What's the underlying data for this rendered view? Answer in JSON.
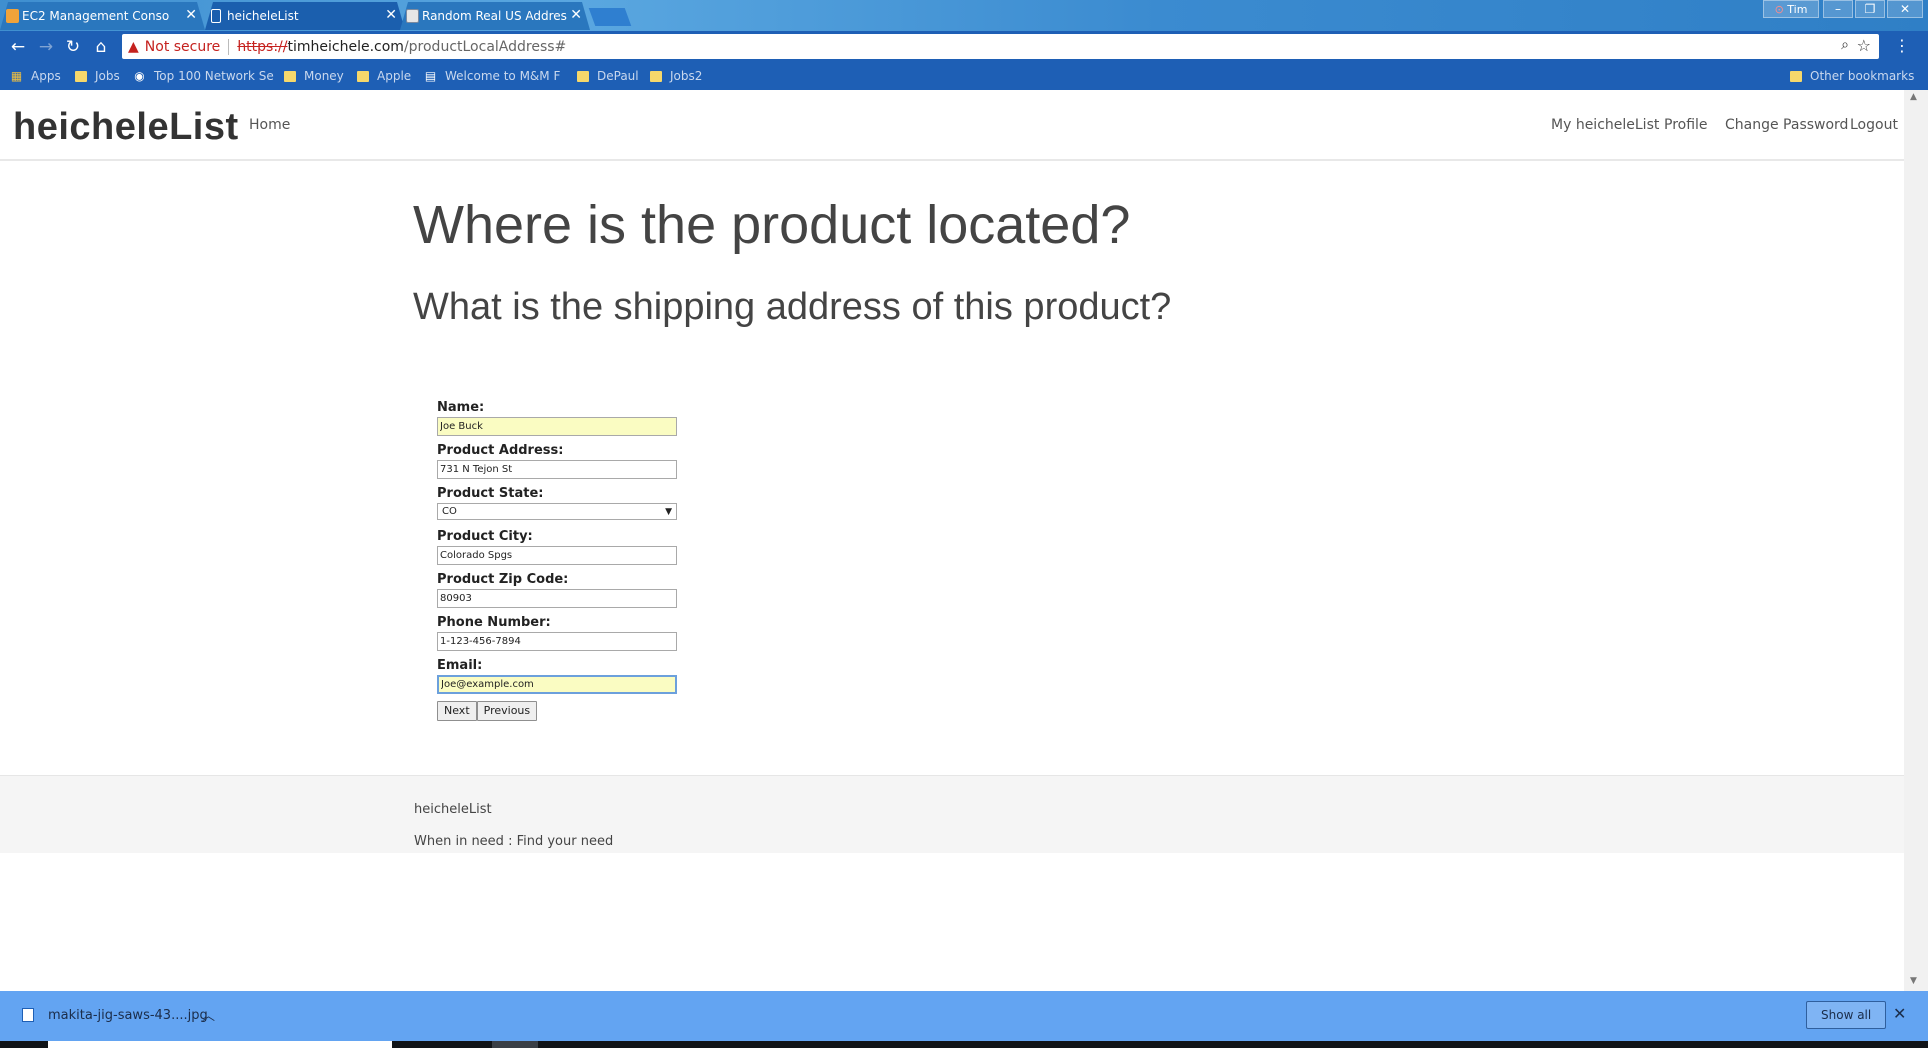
{
  "browser": {
    "tabs": [
      {
        "label": "EC2 Management Conso"
      },
      {
        "label": "heicheleList"
      },
      {
        "label": "Random Real US Addres"
      }
    ],
    "user_badge": "Tim",
    "security_label": "Not secure",
    "url": {
      "scheme": "https://",
      "host": "timheichele.com",
      "path": "/productLocalAddress#"
    },
    "bookmarks": [
      "Apps",
      "Jobs",
      "Top 100 Network Se",
      "Money",
      "Apple",
      "Welcome to M&M F",
      "DePaul",
      "Jobs2"
    ],
    "other_bookmarks": "Other bookmarks"
  },
  "site": {
    "brand": "heicheleList",
    "nav_left": [
      "Home"
    ],
    "nav_right": [
      "My heicheleList",
      "Profile",
      "Change Password",
      "Logout"
    ]
  },
  "page": {
    "title": "Where is the product located?",
    "subtitle": "What is the shipping address of this product?"
  },
  "form": {
    "name": {
      "label": "Name:",
      "value": "Joe Buck"
    },
    "address": {
      "label": "Product Address:",
      "value": "731 N Tejon St"
    },
    "state": {
      "label": "Product State:",
      "value": "CO"
    },
    "city": {
      "label": "Product City:",
      "value": "Colorado Spgs"
    },
    "zip": {
      "label": "Product Zip Code:",
      "value": "80903"
    },
    "phone": {
      "label": "Phone Number:",
      "value": "1-123-456-7894"
    },
    "email": {
      "label": "Email:",
      "value": "Joe@example.com"
    },
    "next_label": "Next",
    "previous_label": "Previous"
  },
  "footer": {
    "brand": "heicheleList",
    "tagline": "When in need : Find your need"
  },
  "downloads": {
    "file_name": "makita-jig-saws-43....jpg",
    "show_all_label": "Show all"
  }
}
